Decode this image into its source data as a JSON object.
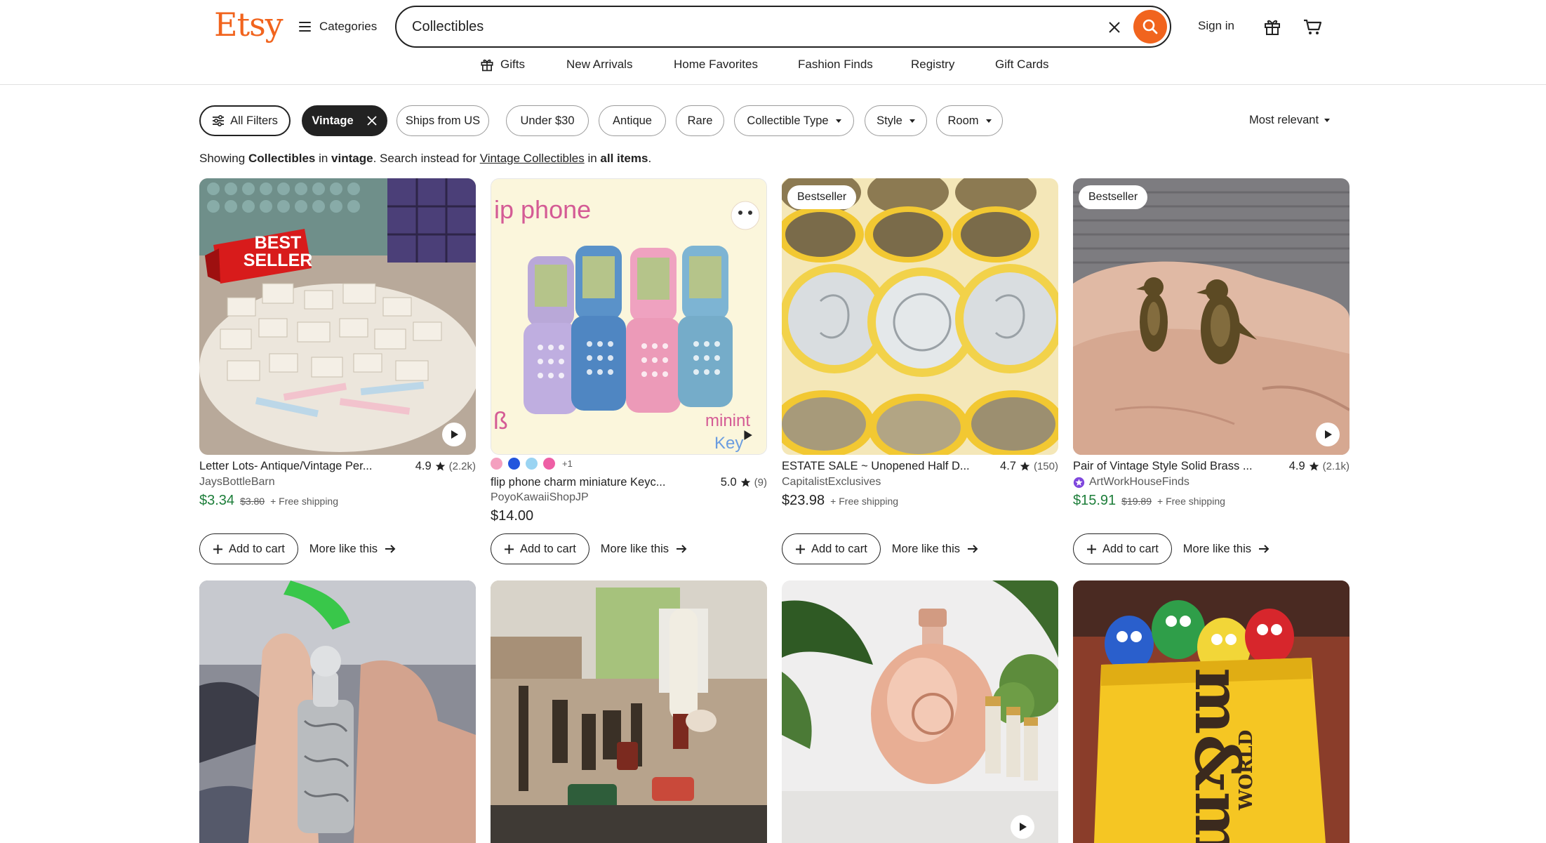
{
  "header": {
    "logo": "Etsy",
    "categories_label": "Categories",
    "search_value": "Collectibles",
    "signin_label": "Sign in",
    "brand_color": "#f1641e"
  },
  "nav": [
    "Gifts",
    "New Arrivals",
    "Home Favorites",
    "Fashion Finds",
    "Registry",
    "Gift Cards"
  ],
  "filters": {
    "chips": [
      "All Filters",
      "Vintage",
      "Ships from US",
      "Under $30",
      "Antique",
      "Rare",
      "Collectible Type",
      "Style",
      "Room"
    ],
    "sort_label": "Most relevant"
  },
  "showing": {
    "p1": "Showing ",
    "query": "Collectibles",
    "p2": " in ",
    "category": "vintage",
    "p3": ". Search instead for ",
    "alt_link": "Vintage Collectibles",
    "p4": " in ",
    "scope": "all items",
    "p5": "."
  },
  "products": [
    {
      "title": "Letter Lots- Antique/Vintage Per...",
      "rating": "4.9",
      "reviews": "(2.2k)",
      "shop": "JaysBottleBarn",
      "price": "$3.34",
      "original_price": "$3.80",
      "shipping": "+ Free shipping",
      "image_text": [
        "BEST",
        "SELLER"
      ]
    },
    {
      "title": "flip phone charm miniature Keyc...",
      "rating": "5.0",
      "reviews": "(9)",
      "shop": "PoyoKawaiiShopJP",
      "price": "$14.00",
      "swatch_colors": [
        "#f4a0bf",
        "#2255dd",
        "#9ad4f2",
        "#ee5fa5"
      ],
      "swatch_more": "+1",
      "image_text": [
        "ip phone",
        "minint",
        "Key"
      ]
    },
    {
      "badge": "Bestseller",
      "title": "ESTATE SALE ~ Unopened Half D...",
      "rating": "4.7",
      "reviews": "(150)",
      "shop": "CapitalistExclusives",
      "price": "$23.98",
      "shipping": "+ Free shipping"
    },
    {
      "badge": "Bestseller",
      "title": "Pair of Vintage Style Solid Brass ...",
      "rating": "4.9",
      "reviews": "(2.1k)",
      "shop": "ArtWorkHouseFinds",
      "price": "$15.91",
      "original_price": "$19.89",
      "shipping": "+ Free shipping"
    }
  ],
  "card_actions": {
    "add_to_cart": "Add to cart",
    "more_like": "More like this"
  },
  "row2_image_text": [
    "WORLD"
  ]
}
